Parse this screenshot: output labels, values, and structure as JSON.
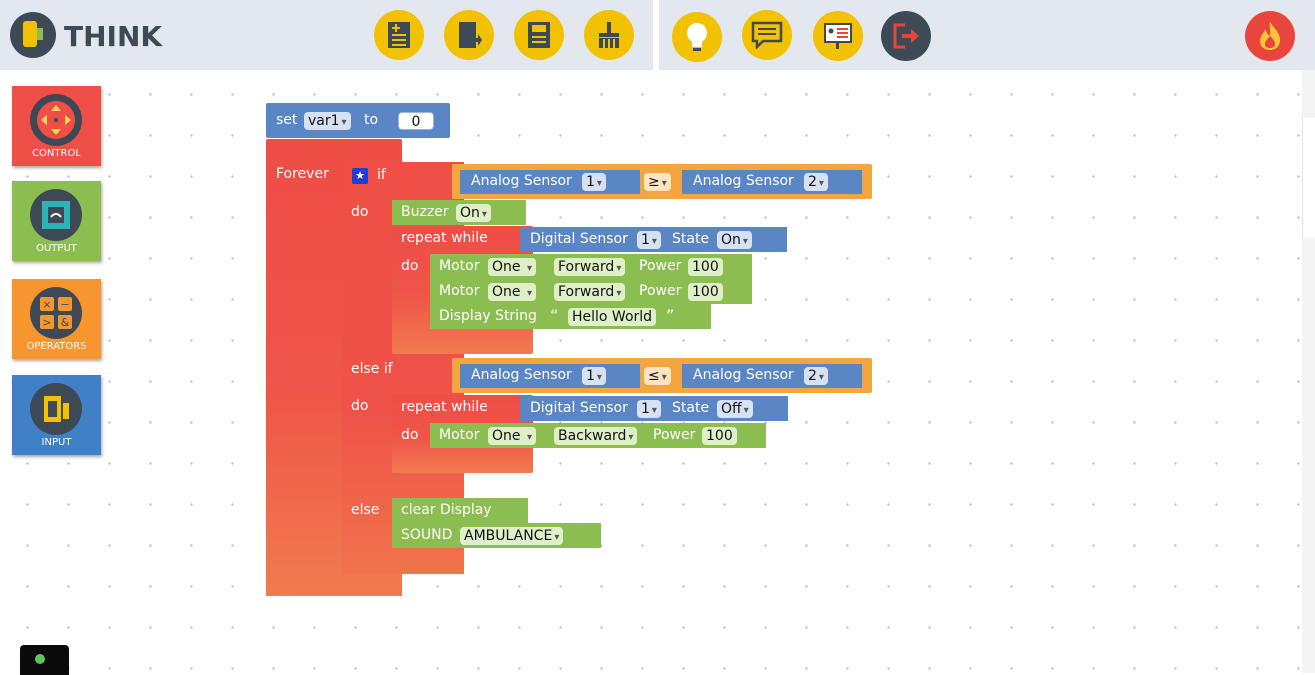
{
  "app": {
    "logo_text": "THINK"
  },
  "toolbar": {
    "buttons": [
      {
        "name": "new-file",
        "icon": "new-file-icon"
      },
      {
        "name": "open-file",
        "icon": "open-folder-icon"
      },
      {
        "name": "save-file",
        "icon": "save-icon"
      },
      {
        "name": "clear-workspace",
        "icon": "broom-icon"
      },
      {
        "name": "ideas",
        "icon": "lightbulb-icon"
      },
      {
        "name": "chat",
        "icon": "chat-icon"
      },
      {
        "name": "presentation",
        "icon": "presentation-icon"
      },
      {
        "name": "logout",
        "icon": "logout-icon"
      }
    ],
    "flame_icon": "flame-icon"
  },
  "categories": [
    {
      "label": "CONTROL",
      "color": "#ef4f46",
      "icon": "dpad-icon"
    },
    {
      "label": "OUTPUT",
      "color": "#8cbd50",
      "icon": "output-device-icon"
    },
    {
      "label": "OPERATORS",
      "color": "#f7952f",
      "icon": "math-operators-icon"
    },
    {
      "label": "INPUT",
      "color": "#3f80c6",
      "icon": "input-sensor-icon"
    }
  ],
  "blocks": {
    "set": {
      "prefix": "set",
      "var": "var1",
      "to": "to",
      "value": "0"
    },
    "forever": "Forever",
    "if_label": "if",
    "do_label": "do",
    "else_if_label": "else if",
    "else_label": "else",
    "cond1": {
      "left_sensor": "Analog Sensor",
      "left_port": "1",
      "op": "≥",
      "right_sensor": "Analog Sensor",
      "right_port": "2"
    },
    "buzzer": {
      "label": "Buzzer",
      "state": "On"
    },
    "repeat_while": "repeat while",
    "dsensor1": {
      "label": "Digital Sensor",
      "port": "1",
      "state_label": "State",
      "state": "On"
    },
    "motor_rows": [
      {
        "label": "Motor",
        "motor": "One",
        "direction": "Forward",
        "power_label": "Power",
        "power": "100"
      },
      {
        "label": "Motor",
        "motor": "One",
        "direction": "Forward",
        "power_label": "Power",
        "power": "100"
      }
    ],
    "display": {
      "label": "Display String",
      "open_quote": "“",
      "text": "Hello World",
      "close_quote": "”"
    },
    "cond2": {
      "left_sensor": "Analog Sensor",
      "left_port": "1",
      "op": "≤",
      "right_sensor": "Analog Sensor",
      "right_port": "2"
    },
    "dsensor2": {
      "label": "Digital Sensor",
      "port": "1",
      "state_label": "State",
      "state": "Off"
    },
    "motor3": {
      "label": "Motor",
      "motor": "One",
      "direction": "Backward",
      "power_label": "Power",
      "power": "100"
    },
    "clear_display": "clear Display",
    "sound": {
      "label": "SOUND",
      "value": "AMBULANCE"
    },
    "dropdown_arrow": "▾"
  },
  "colors": {
    "control": "#ef4f46",
    "output": "#8cbd50",
    "sensor": "#5b86c5",
    "operator": "#f2a641",
    "toolbar_button": "#f2c200"
  }
}
